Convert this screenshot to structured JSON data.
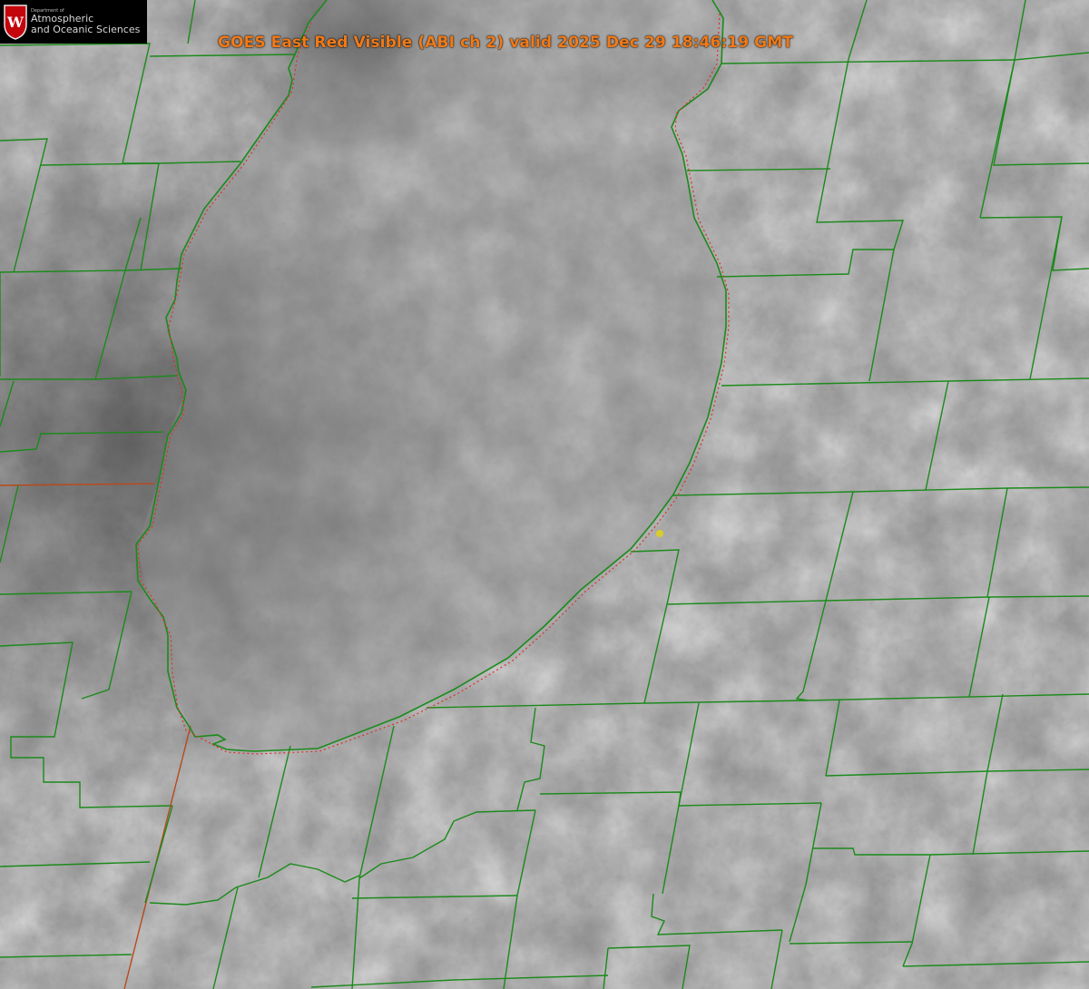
{
  "header": {
    "title": "GOES East Red Visible (ABI ch 2) valid 2025 Dec 29 18:46:19 GMT"
  },
  "logo": {
    "dept": "Department of",
    "line1": "Atmospheric",
    "line2": "and Oceanic Sciences",
    "crest_letter": "W"
  },
  "colors": {
    "county_lines": "#1b8a1b",
    "shoreline_dots": "#e0302a",
    "state_line": "#b8491c",
    "marker": "#d9cc2b",
    "title": "#f07a18",
    "logo_crest": "#c5050c"
  },
  "map": {
    "feature": "lake-michigan-southern-basin",
    "marker_icon": "yellow-dot-icon"
  }
}
